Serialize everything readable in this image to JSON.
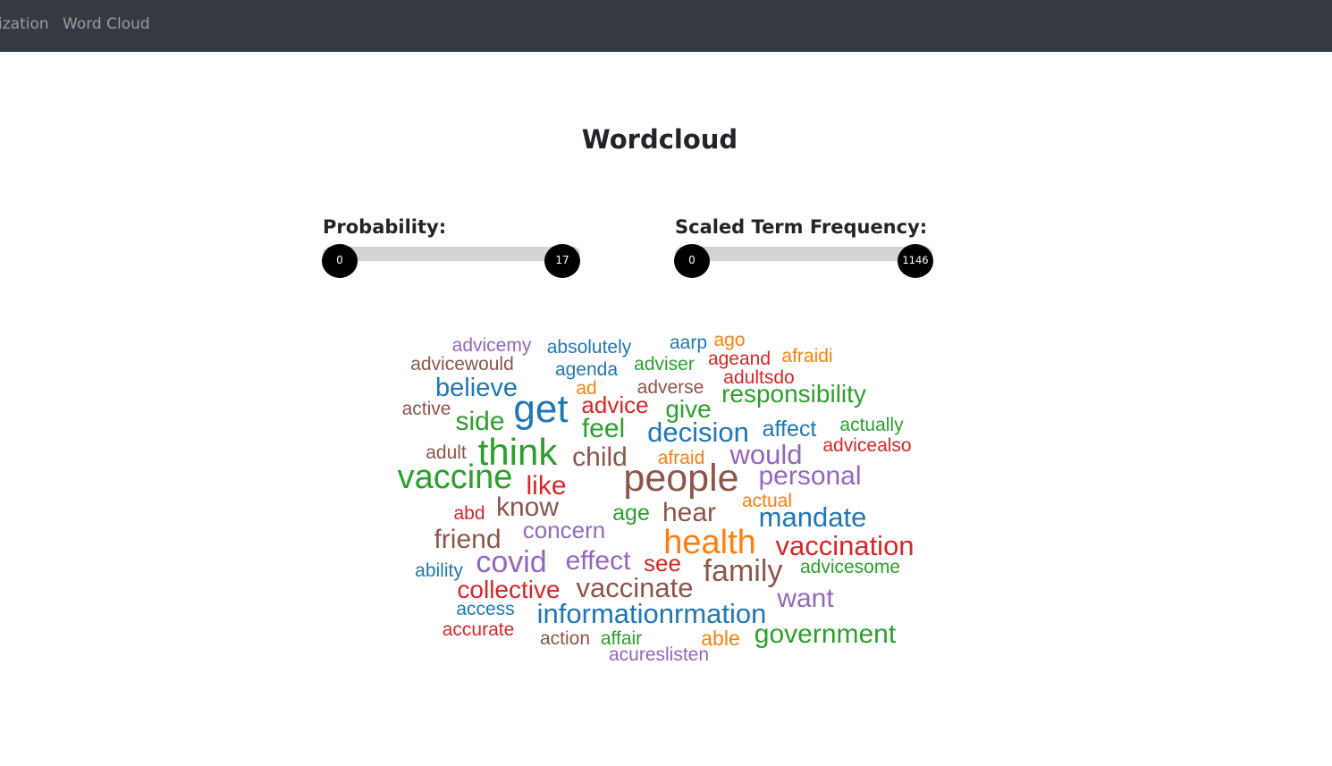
{
  "navbar": {
    "items": [
      {
        "label": "ization"
      },
      {
        "label": "Word Cloud"
      }
    ]
  },
  "page": {
    "title": "Wordcloud"
  },
  "filters": {
    "probability": {
      "label": "Probability:",
      "min_value": "0",
      "max_value": "17"
    },
    "scaled_term_frequency": {
      "label": "Scaled Term Frequency:",
      "min_value": "0",
      "max_value": "1146"
    }
  },
  "palette": {
    "blue": "#1f77b4",
    "orange": "#ff7f0e",
    "green": "#2ca02c",
    "red": "#d62728",
    "purple": "#9467bd",
    "brown": "#8c564b"
  },
  "wordcloud": {
    "words": [
      {
        "text": "advicemy",
        "color": "purple"
      },
      {
        "text": "absolutely",
        "color": "blue"
      },
      {
        "text": "aarp",
        "color": "blue"
      },
      {
        "text": "ago",
        "color": "orange"
      },
      {
        "text": "advicewould",
        "color": "brown"
      },
      {
        "text": "agenda",
        "color": "blue"
      },
      {
        "text": "adviser",
        "color": "green"
      },
      {
        "text": "ageand",
        "color": "red"
      },
      {
        "text": "afraidi",
        "color": "orange"
      },
      {
        "text": "adultsdo",
        "color": "red"
      },
      {
        "text": "believe",
        "color": "blue"
      },
      {
        "text": "ad",
        "color": "orange"
      },
      {
        "text": "adverse",
        "color": "brown"
      },
      {
        "text": "responsibility",
        "color": "green"
      },
      {
        "text": "active",
        "color": "brown"
      },
      {
        "text": "side",
        "color": "green"
      },
      {
        "text": "get",
        "color": "blue"
      },
      {
        "text": "advice",
        "color": "red"
      },
      {
        "text": "give",
        "color": "green"
      },
      {
        "text": "feel",
        "color": "green"
      },
      {
        "text": "decision",
        "color": "blue"
      },
      {
        "text": "affect",
        "color": "blue"
      },
      {
        "text": "actually",
        "color": "green"
      },
      {
        "text": "adult",
        "color": "brown"
      },
      {
        "text": "think",
        "color": "green"
      },
      {
        "text": "child",
        "color": "brown"
      },
      {
        "text": "would",
        "color": "purple"
      },
      {
        "text": "advicealso",
        "color": "red"
      },
      {
        "text": "afraid",
        "color": "orange"
      },
      {
        "text": "vaccine",
        "color": "green"
      },
      {
        "text": "people",
        "color": "brown"
      },
      {
        "text": "personal",
        "color": "purple"
      },
      {
        "text": "like",
        "color": "red"
      },
      {
        "text": "actual",
        "color": "orange"
      },
      {
        "text": "abd",
        "color": "red"
      },
      {
        "text": "know",
        "color": "brown"
      },
      {
        "text": "age",
        "color": "green"
      },
      {
        "text": "hear",
        "color": "brown"
      },
      {
        "text": "mandate",
        "color": "blue"
      },
      {
        "text": "friend",
        "color": "brown"
      },
      {
        "text": "concern",
        "color": "purple"
      },
      {
        "text": "health",
        "color": "orange"
      },
      {
        "text": "vaccination",
        "color": "red"
      },
      {
        "text": "ability",
        "color": "blue"
      },
      {
        "text": "covid",
        "color": "purple"
      },
      {
        "text": "effect",
        "color": "purple"
      },
      {
        "text": "see",
        "color": "red"
      },
      {
        "text": "family",
        "color": "brown"
      },
      {
        "text": "advicesome",
        "color": "green"
      },
      {
        "text": "collective",
        "color": "red"
      },
      {
        "text": "vaccinate",
        "color": "brown"
      },
      {
        "text": "want",
        "color": "purple"
      },
      {
        "text": "access",
        "color": "blue"
      },
      {
        "text": "informationrmation",
        "color": "blue"
      },
      {
        "text": "accurate",
        "color": "red"
      },
      {
        "text": "action",
        "color": "brown"
      },
      {
        "text": "affair",
        "color": "green"
      },
      {
        "text": "able",
        "color": "orange"
      },
      {
        "text": "government",
        "color": "green"
      },
      {
        "text": "acureslisten",
        "color": "purple"
      }
    ]
  }
}
